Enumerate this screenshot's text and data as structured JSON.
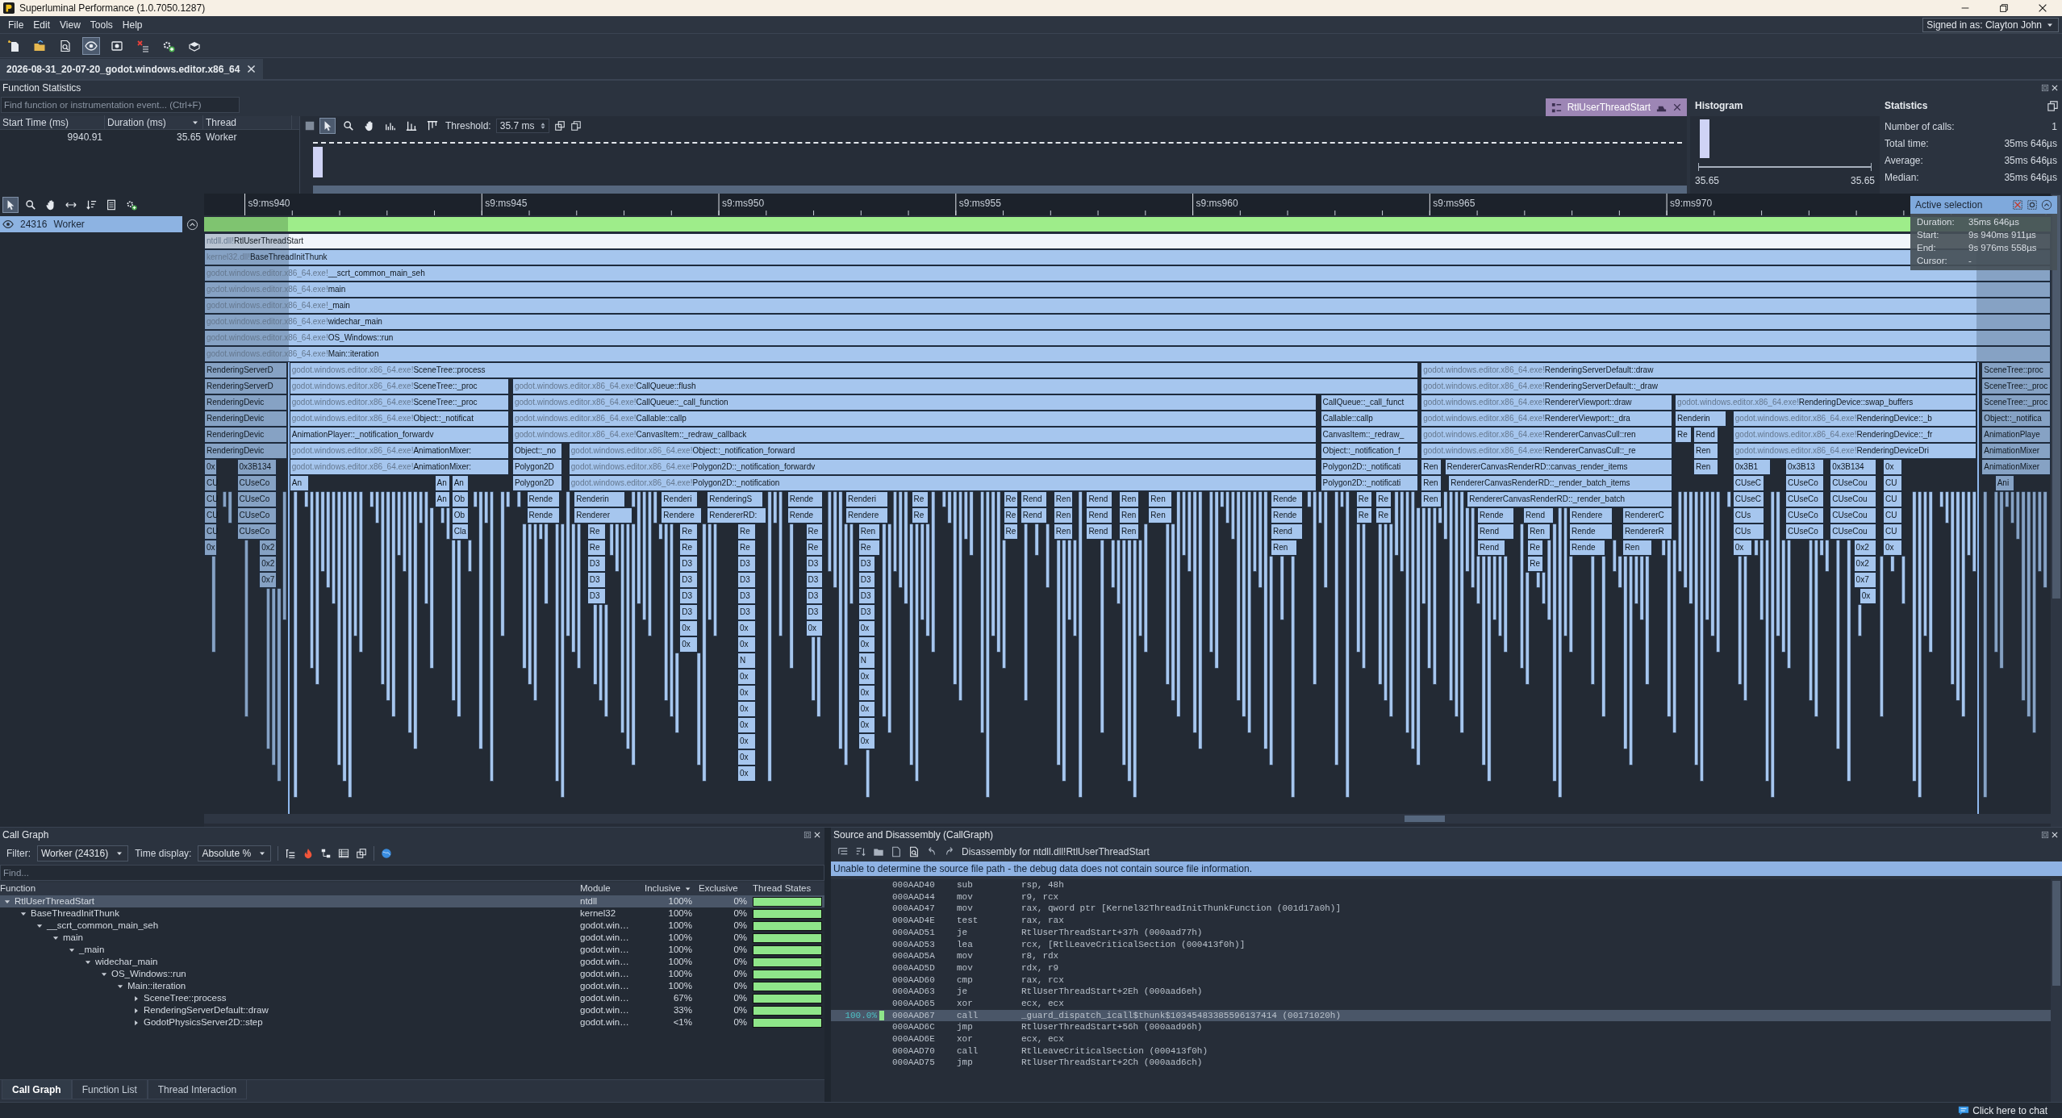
{
  "window": {
    "title": "Superluminal Performance (1.0.7050.1287)"
  },
  "menu": [
    "File",
    "Edit",
    "View",
    "Tools",
    "Help"
  ],
  "account": {
    "label": "Signed in as: Clayton John"
  },
  "toolbar": [
    {
      "selected": false
    },
    {
      "selected": false
    },
    {
      "selected": false
    },
    {
      "selected": true
    },
    {
      "selected": false
    },
    {
      "selected": false
    },
    {
      "selected": false
    },
    {
      "selected": false
    }
  ],
  "document_tabs": [
    {
      "label": "2026-08-31_20-07-20_godot.windows.editor.x86_64",
      "selected": true
    }
  ],
  "function_statistics": {
    "title": "Function Statistics",
    "search": {
      "placeholder": "Find function or instrumentation event... (Ctrl+F)"
    },
    "columns": [
      {
        "label": "Start Time (ms)",
        "sorted": false
      },
      {
        "label": "Duration (ms)",
        "sorted": true
      },
      {
        "label": "Thread",
        "sorted": false
      }
    ],
    "rows": [
      {
        "cells": [
          "9940.91",
          "35.65",
          "Worker"
        ],
        "selected": false
      }
    ],
    "tools": [
      {
        "selected": true
      },
      {
        "selected": false
      },
      {
        "selected": false
      },
      {
        "selected": false
      },
      {
        "selected": false
      },
      {
        "selected": false
      }
    ],
    "threshold_label": "Threshold:",
    "threshold": "35.7 ms",
    "function_tag": "RtlUserThreadStart"
  },
  "histogram": {
    "title": "Histogram",
    "min_label": "35.65",
    "max_label": "35.65"
  },
  "statistics": {
    "title": "Statistics",
    "rows": [
      {
        "label": "Number of calls:",
        "value": "1"
      },
      {
        "label": "Total time:",
        "value": "35ms 646µs"
      },
      {
        "label": "Average:",
        "value": "35ms 646µs"
      },
      {
        "label": "Median:",
        "value": "35ms 646µs"
      }
    ]
  },
  "timeline": {
    "tools": [
      {
        "selected": true
      },
      {
        "selected": false
      },
      {
        "selected": false
      },
      {
        "selected": false
      },
      {
        "selected": false
      },
      {
        "selected": false
      },
      {
        "selected": false
      }
    ],
    "threads": [
      {
        "id": "24316",
        "name": "Worker",
        "selected": true
      }
    ],
    "tick_labels": [
      "s9:ms940",
      "s9:ms945",
      "s9:ms950",
      "s9:ms955",
      "s9:ms960",
      "s9:ms965",
      "s9:ms970"
    ],
    "rows": [
      {
        "frames": [
          {
            "module": "ntdll.dll!",
            "name": "RtlUserThreadStart",
            "selected": true
          }
        ]
      },
      {
        "frames": [
          {
            "module": "kernel32.dll!",
            "name": "BaseThreadInitThunk",
            "selected": false
          }
        ]
      },
      {
        "frames": [
          {
            "module": "godot.windows.editor.x86_64.exe!",
            "name": "__scrt_common_main_seh",
            "selected": false
          }
        ]
      },
      {
        "frames": [
          {
            "module": "godot.windows.editor.x86_64.exe!",
            "name": "main",
            "selected": false
          }
        ]
      },
      {
        "frames": [
          {
            "module": "godot.windows.editor.x86_64.exe!",
            "name": "_main",
            "selected": false
          }
        ]
      },
      {
        "frames": [
          {
            "module": "godot.windows.editor.x86_64.exe!",
            "name": "widechar_main",
            "selected": false
          }
        ]
      },
      {
        "frames": [
          {
            "module": "godot.windows.editor.x86_64.exe!",
            "name": "OS_Windows::run",
            "selected": false
          }
        ]
      },
      {
        "frames": [
          {
            "module": "godot.windows.editor.x86_64.exe!",
            "name": "Main::iteration",
            "selected": false
          }
        ]
      },
      {
        "frames": [
          {
            "name": "RenderingServerD",
            "selected": false
          },
          {
            "module": "godot.windows.editor.x86_64.exe!",
            "name": "SceneTree::process",
            "selected": false
          },
          {
            "module": "godot.windows.editor.x86_64.exe!",
            "name": "RenderingServerDefault::draw",
            "selected": false
          },
          {
            "name": "SceneTree::proc",
            "selected": false
          }
        ]
      },
      {
        "frames": [
          {
            "name": "RenderingServerD",
            "selected": false
          },
          {
            "module": "godot.windows.editor.x86_64.exe!",
            "name": "SceneTree::_proc",
            "selected": false
          },
          {
            "module": "godot.windows.editor.x86_64.exe!",
            "name": "CallQueue::flush",
            "selected": false
          },
          {
            "module": "godot.windows.editor.x86_64.exe!",
            "name": "RenderingServerDefault::_draw",
            "selected": false
          },
          {
            "name": "SceneTree::_proc",
            "selected": false
          }
        ]
      },
      {
        "frames": [
          {
            "name": "RenderingDevic",
            "selected": false
          },
          {
            "module": "godot.windows.editor.x86_64.exe!",
            "name": "SceneTree::_proc",
            "selected": false
          },
          {
            "module": "godot.windows.editor.x86_64.exe!",
            "name": "CallQueue::_call_function",
            "selected": false
          },
          {
            "name": "CallQueue::_call_funct",
            "selected": false
          },
          {
            "module": "godot.windows.editor.x86_64.exe!",
            "name": "RendererViewport::draw",
            "selected": false
          },
          {
            "module": "godot.windows.editor.x86_64.exe!",
            "name": "RenderingDevice::swap_buffers",
            "selected": false
          },
          {
            "name": "SceneTree::_proc",
            "selected": false
          }
        ]
      },
      {
        "frames": [
          {
            "name": "RenderingDevic",
            "selected": false
          },
          {
            "module": "godot.windows.editor.x86_64.exe!",
            "name": "Object::_notificat",
            "selected": false
          },
          {
            "module": "godot.windows.editor.x86_64.exe!",
            "name": "Callable::callp",
            "selected": false
          },
          {
            "name": "Callable::callp",
            "selected": false
          },
          {
            "module": "godot.windows.editor.x86_64.exe!",
            "name": "RendererViewport::_dra",
            "selected": false
          },
          {
            "name": "Renderin",
            "selected": false
          },
          {
            "module": "godot.windows.editor.x86_64.exe!",
            "name": "RenderingDevice::_b",
            "selected": false
          },
          {
            "name": "Object::_notifica",
            "selected": false
          }
        ]
      },
      {
        "frames": [
          {
            "name": "RenderingDevic",
            "selected": false
          },
          {
            "name": "AnimationPlayer::_notification_forwardv",
            "selected": false
          },
          {
            "module": "godot.windows.editor.x86_64.exe!",
            "name": "CanvasItem::_redraw_callback",
            "selected": false
          },
          {
            "name": "CanvasItem::_redraw_",
            "selected": false
          },
          {
            "module": "godot.windows.editor.x86_64.exe!",
            "name": "RendererCanvasCull::ren",
            "selected": false
          },
          {
            "name": "Re",
            "selected": false
          },
          {
            "name": "Rend",
            "selected": false
          },
          {
            "module": "godot.windows.editor.x86_64.exe!",
            "name": "RenderingDevice::_fr",
            "selected": false
          },
          {
            "name": "AnimationPlaye",
            "selected": false
          }
        ]
      },
      {
        "frames": [
          {
            "name": "RenderingDevic",
            "selected": false
          },
          {
            "module": "godot.windows.editor.x86_64.exe!",
            "name": "AnimationMixer:",
            "selected": false
          },
          {
            "name": "Object::_no",
            "selected": false
          },
          {
            "module": "godot.windows.editor.x86_64.exe!",
            "name": "Object::_notification_forward",
            "selected": false
          },
          {
            "name": "Object::_notification_f",
            "selected": false
          },
          {
            "module": "godot.windows.editor.x86_64.exe!",
            "name": "RendererCanvasCull::_re",
            "selected": false
          },
          {
            "name": "Ren",
            "selected": false
          },
          {
            "module": "godot.windows.editor.x86_64.exe!",
            "name": "RenderingDeviceDri",
            "selected": false
          },
          {
            "name": "AnimationMixer",
            "selected": false
          }
        ]
      },
      {
        "frames": [
          {
            "name": "0x",
            "selected": false
          },
          {
            "name": "0x3B134",
            "selected": false
          },
          {
            "module": "godot.windows.editor.x86_64.exe!",
            "name": "AnimationMixer:",
            "selected": false
          },
          {
            "name": "Polygon2D",
            "selected": false
          },
          {
            "module": "godot.windows.editor.x86_64.exe!",
            "name": "Polygon2D::_notification_forwardv",
            "selected": false
          },
          {
            "name": "Polygon2D::_notificati",
            "selected": false
          },
          {
            "name": "Ren",
            "selected": false
          },
          {
            "name": "RendererCanvasRenderRD::canvas_render_items",
            "selected": false
          },
          {
            "name": "Ren",
            "selected": false
          },
          {
            "name": "0x3B1",
            "selected": false
          },
          {
            "name": "0x3B13",
            "selected": false
          },
          {
            "name": "0x3B134",
            "selected": false
          },
          {
            "name": "0x",
            "selected": false
          },
          {
            "name": "AnimationMixer",
            "selected": false
          }
        ]
      },
      {
        "frames": [
          {
            "name": "CU",
            "selected": false
          },
          {
            "name": "CUseCo",
            "selected": false
          },
          {
            "name": "An",
            "selected": false
          },
          {
            "name": "An",
            "selected": false
          },
          {
            "name": "An",
            "selected": false
          },
          {
            "name": "Polygon2D",
            "selected": false
          },
          {
            "module": "godot.windows.editor.x86_64.exe!",
            "name": "Polygon2D::_notification",
            "selected": false
          },
          {
            "name": "Polygon2D::_notificati",
            "selected": false
          },
          {
            "name": "Ren",
            "selected": false
          },
          {
            "name": "RendererCanvasRenderRD::_render_batch_items",
            "selected": false
          },
          {
            "name": "CUseC",
            "selected": false
          },
          {
            "name": "CUseCo",
            "selected": false
          },
          {
            "name": "CUseCou",
            "selected": false
          },
          {
            "name": "CU",
            "selected": false
          },
          {
            "name": "Ani",
            "selected": false
          }
        ]
      },
      {
        "frames": [
          {
            "name": "CU",
            "selected": false
          },
          {
            "name": "CUseCo",
            "selected": false
          },
          {
            "name": "An",
            "selected": false
          },
          {
            "name": "Ob",
            "selected": false
          },
          {
            "name": "Rende",
            "selected": false
          },
          {
            "name": "Renderin",
            "selected": false
          },
          {
            "name": "Renderi",
            "selected": false
          },
          {
            "name": "RenderingS",
            "selected": false
          },
          {
            "name": "Rende",
            "selected": false
          },
          {
            "name": "Renderi",
            "selected": false
          },
          {
            "name": "Re",
            "selected": false
          },
          {
            "name": "Re",
            "selected": false
          },
          {
            "name": "Rend",
            "selected": false
          },
          {
            "name": "Ren",
            "selected": false
          },
          {
            "name": "Rend",
            "selected": false
          },
          {
            "name": "Ren",
            "selected": false
          },
          {
            "name": "Ren",
            "selected": false
          },
          {
            "name": "Rende",
            "selected": false
          },
          {
            "name": "Re",
            "selected": false
          },
          {
            "name": "Re",
            "selected": false
          },
          {
            "name": "Ren",
            "selected": false
          },
          {
            "name": "RendererCanvasRenderRD::_render_batch",
            "selected": false
          },
          {
            "name": "CUseC",
            "selected": false
          },
          {
            "name": "CUseCo",
            "selected": false
          },
          {
            "name": "CUseCou",
            "selected": false
          },
          {
            "name": "CU",
            "selected": false
          }
        ]
      },
      {
        "frames": [
          {
            "name": "CU",
            "selected": false
          },
          {
            "name": "CUseCo",
            "selected": false
          },
          {
            "name": "Ob",
            "selected": false
          },
          {
            "name": "Rende",
            "selected": false
          },
          {
            "name": "Renderer",
            "selected": false
          },
          {
            "name": "Rendere",
            "selected": false
          },
          {
            "name": "RendererRD:",
            "selected": false
          },
          {
            "name": "Rende",
            "selected": false
          },
          {
            "name": "Rendere",
            "selected": false
          },
          {
            "name": "Re",
            "selected": false
          },
          {
            "name": "Re",
            "selected": false
          },
          {
            "name": "Rend",
            "selected": false
          },
          {
            "name": "Ren",
            "selected": false
          },
          {
            "name": "Rend",
            "selected": false
          },
          {
            "name": "Ren",
            "selected": false
          },
          {
            "name": "Ren",
            "selected": false
          },
          {
            "name": "Rende",
            "selected": false
          },
          {
            "name": "Re",
            "selected": false
          },
          {
            "name": "Re",
            "selected": false
          },
          {
            "name": "Rende",
            "selected": false
          },
          {
            "name": "Rend",
            "selected": false
          },
          {
            "name": "Rendere",
            "selected": false
          },
          {
            "name": "RendererC",
            "selected": false
          },
          {
            "name": "CUs",
            "selected": false
          },
          {
            "name": "CUseCo",
            "selected": false
          },
          {
            "name": "CUseCou",
            "selected": false
          },
          {
            "name": "CU",
            "selected": false
          }
        ]
      },
      {
        "frames": [
          {
            "name": "CU",
            "selected": false
          },
          {
            "name": "CUseCo",
            "selected": false
          },
          {
            "name": "Cla",
            "selected": false
          },
          {
            "name": "Re",
            "selected": false
          },
          {
            "name": "Re",
            "selected": false
          },
          {
            "name": "Re",
            "selected": false
          },
          {
            "name": "Re",
            "selected": false
          },
          {
            "name": "Ren",
            "selected": false
          },
          {
            "name": "Re",
            "selected": false
          },
          {
            "name": "Ren",
            "selected": false
          },
          {
            "name": "Rend",
            "selected": false
          },
          {
            "name": "Ren",
            "selected": false
          },
          {
            "name": "Rend",
            "selected": false
          },
          {
            "name": "Rend",
            "selected": false
          },
          {
            "name": "Ren",
            "selected": false
          },
          {
            "name": "Rende",
            "selected": false
          },
          {
            "name": "RendererR",
            "selected": false
          },
          {
            "name": "CUs",
            "selected": false
          },
          {
            "name": "CUseCo",
            "selected": false
          },
          {
            "name": "CUseCou",
            "selected": false
          },
          {
            "name": "CU",
            "selected": false
          }
        ]
      },
      {
        "frames": [
          {
            "name": "0x",
            "selected": false
          },
          {
            "name": "0x2",
            "selected": false
          },
          {
            "name": "Re",
            "selected": false
          },
          {
            "name": "Re",
            "selected": false
          },
          {
            "name": "Re",
            "selected": false
          },
          {
            "name": "Re",
            "selected": false
          },
          {
            "name": "Re",
            "selected": false
          },
          {
            "name": "Ren",
            "selected": false
          },
          {
            "name": "Rend",
            "selected": false
          },
          {
            "name": "Re",
            "selected": false
          },
          {
            "name": "Rende",
            "selected": false
          },
          {
            "name": "Ren",
            "selected": false
          },
          {
            "name": "0x",
            "selected": false
          },
          {
            "name": "0x2",
            "selected": false
          },
          {
            "name": "0x",
            "selected": false
          }
        ]
      },
      {
        "frames": [
          {
            "name": "0x2",
            "selected": false
          },
          {
            "name": "D3",
            "selected": false
          },
          {
            "name": "D3",
            "selected": false
          },
          {
            "name": "D3",
            "selected": false
          },
          {
            "name": "D3",
            "selected": false
          },
          {
            "name": "D3",
            "selected": false
          },
          {
            "name": "Re",
            "selected": false
          },
          {
            "name": "0x2",
            "selected": false
          }
        ]
      },
      {
        "frames": [
          {
            "name": "0x7",
            "selected": false
          },
          {
            "name": "D3",
            "selected": false
          },
          {
            "name": "D3",
            "selected": false
          },
          {
            "name": "D3",
            "selected": false
          },
          {
            "name": "D3",
            "selected": false
          },
          {
            "name": "D3",
            "selected": false
          },
          {
            "name": "0x7",
            "selected": false
          }
        ]
      },
      {
        "frames": [
          {
            "name": "D3",
            "selected": false
          },
          {
            "name": "D3",
            "selected": false
          },
          {
            "name": "D3",
            "selected": false
          },
          {
            "name": "D3",
            "selected": false
          },
          {
            "name": "D3",
            "selected": false
          },
          {
            "name": "0x",
            "selected": false
          }
        ]
      },
      {
        "frames": [
          {
            "name": "D3",
            "selected": false
          },
          {
            "name": "D3",
            "selected": false
          },
          {
            "name": "D3",
            "selected": false
          },
          {
            "name": "D3",
            "selected": false
          }
        ]
      },
      {
        "frames": [
          {
            "name": "0x",
            "selected": false
          },
          {
            "name": "0x",
            "selected": false
          },
          {
            "name": "0x",
            "selected": false
          },
          {
            "name": "0x",
            "selected": false
          }
        ]
      },
      {
        "frames": [
          {
            "name": "0x",
            "selected": false
          },
          {
            "name": "0x",
            "selected": false
          },
          {
            "name": "0x",
            "selected": false
          }
        ]
      },
      {
        "frames": [
          {
            "name": "N",
            "selected": false
          },
          {
            "name": "N",
            "selected": false
          }
        ]
      },
      {
        "frames": [
          {
            "name": "0x",
            "selected": false
          },
          {
            "name": "0x",
            "selected": false
          }
        ]
      },
      {
        "frames": [
          {
            "name": "0x",
            "selected": false
          },
          {
            "name": "0x",
            "selected": false
          }
        ]
      },
      {
        "frames": [
          {
            "name": "0x",
            "selected": false
          },
          {
            "name": "0x",
            "selected": false
          }
        ]
      },
      {
        "frames": [
          {
            "name": "0x",
            "selected": false
          },
          {
            "name": "0x",
            "selected": false
          }
        ]
      },
      {
        "frames": [
          {
            "name": "0x",
            "selected": false
          },
          {
            "name": "0x",
            "selected": false
          }
        ]
      },
      {
        "frames": [
          {
            "name": "0x",
            "selected": false
          }
        ]
      },
      {
        "frames": [
          {
            "name": "0x",
            "selected": false
          }
        ]
      }
    ]
  },
  "active_selection": {
    "title": "Active selection",
    "rows": [
      {
        "label": "Duration:",
        "value": "35ms 646µs"
      },
      {
        "label": "Start:",
        "value": "9s 940ms 911µs"
      },
      {
        "label": "End:",
        "value": "9s 976ms 558µs"
      },
      {
        "label": "Cursor:",
        "value": "-"
      }
    ]
  },
  "call_graph": {
    "title": "Call Graph",
    "filter_label": "Filter:",
    "filter": "Worker (24316)",
    "time_display_label": "Time display:",
    "time_display": "Absolute %",
    "find": {
      "placeholder": "Find..."
    },
    "columns": [
      {
        "label": "Function",
        "sorted": false
      },
      {
        "label": "Module",
        "sorted": false
      },
      {
        "label": "Inclusive",
        "sorted": true
      },
      {
        "label": "Exclusive",
        "sorted": false
      },
      {
        "label": "Thread States",
        "sorted": false
      }
    ],
    "tree": [
      {
        "name": "RtlUserThreadStart",
        "module": "ntdll",
        "inclusive": "100%",
        "exclusive": "0%",
        "expanded": true,
        "selected": true,
        "children": [
          {
            "name": "BaseThreadInitThunk",
            "module": "kernel32",
            "inclusive": "100%",
            "exclusive": "0%",
            "expanded": true,
            "selected": false,
            "children": [
              {
                "name": "__scrt_common_main_seh",
                "module": "godot.win…",
                "inclusive": "100%",
                "exclusive": "0%",
                "expanded": true,
                "selected": false,
                "children": [
                  {
                    "name": "main",
                    "module": "godot.win…",
                    "inclusive": "100%",
                    "exclusive": "0%",
                    "expanded": true,
                    "selected": false,
                    "children": [
                      {
                        "name": "_main",
                        "module": "godot.win…",
                        "inclusive": "100%",
                        "exclusive": "0%",
                        "expanded": true,
                        "selected": false,
                        "children": [
                          {
                            "name": "widechar_main",
                            "module": "godot.win…",
                            "inclusive": "100%",
                            "exclusive": "0%",
                            "expanded": true,
                            "selected": false,
                            "children": [
                              {
                                "name": "OS_Windows::run",
                                "module": "godot.win…",
                                "inclusive": "100%",
                                "exclusive": "0%",
                                "expanded": true,
                                "selected": false,
                                "children": [
                                  {
                                    "name": "Main::iteration",
                                    "module": "godot.win…",
                                    "inclusive": "100%",
                                    "exclusive": "0%",
                                    "expanded": true,
                                    "selected": false,
                                    "children": [
                                      {
                                        "name": "SceneTree::process",
                                        "module": "godot.win…",
                                        "inclusive": "67%",
                                        "exclusive": "0%",
                                        "expanded": false,
                                        "selected": false
                                      },
                                      {
                                        "name": "RenderingServerDefault::draw",
                                        "module": "godot.win…",
                                        "inclusive": "33%",
                                        "exclusive": "0%",
                                        "expanded": false,
                                        "selected": false
                                      },
                                      {
                                        "name": "GodotPhysicsServer2D::step",
                                        "module": "godot.win…",
                                        "inclusive": "<1%",
                                        "exclusive": "0%",
                                        "expanded": false,
                                        "selected": false
                                      }
                                    ]
                                  }
                                ]
                              }
                            ]
                          }
                        ]
                      }
                    ]
                  }
                ]
              }
            ]
          }
        ]
      }
    ],
    "tabs": [
      {
        "label": "Call Graph",
        "selected": true
      },
      {
        "label": "Function List",
        "selected": false
      },
      {
        "label": "Thread Interaction",
        "selected": false
      }
    ]
  },
  "disassembly": {
    "title": "Source and Disassembly (CallGraph)",
    "heading": "Disassembly for ntdll.dll!RtlUserThreadStart",
    "notice": "Unable to determine the source file path - the debug data does not contain source file information.",
    "lines": [
      {
        "address": "000AAD40",
        "op": "sub",
        "args": "rsp, 48h",
        "selected": false
      },
      {
        "address": "000AAD44",
        "op": "mov",
        "args": "r9, rcx",
        "selected": false
      },
      {
        "address": "000AAD47",
        "op": "mov",
        "args": "rax, qword ptr [Kernel32ThreadInitThunkFunction (001d17a0h)]",
        "selected": false
      },
      {
        "address": "000AAD4E",
        "op": "test",
        "args": "rax, rax",
        "selected": false
      },
      {
        "address": "000AAD51",
        "op": "je",
        "args": "RtlUserThreadStart+37h (000aad77h)",
        "selected": false
      },
      {
        "address": "000AAD53",
        "op": "lea",
        "args": "rcx, [RtlLeaveCriticalSection (000413f0h)]",
        "selected": false
      },
      {
        "address": "000AAD5A",
        "op": "mov",
        "args": "r8, rdx",
        "selected": false
      },
      {
        "address": "000AAD5D",
        "op": "mov",
        "args": "rdx, r9",
        "selected": false
      },
      {
        "address": "000AAD60",
        "op": "cmp",
        "args": "rax, rcx",
        "selected": false
      },
      {
        "address": "000AAD63",
        "op": "je",
        "args": "RtlUserThreadStart+2Eh (000aad6eh)",
        "selected": false
      },
      {
        "address": "000AAD65",
        "op": "xor",
        "args": "ecx, ecx",
        "selected": false
      },
      {
        "address": "000AAD67",
        "op": "call",
        "args": "_guard_dispatch_icall$thunk$10345483385596137414 (00171020h)",
        "selected": true,
        "percent": "100.0%"
      },
      {
        "address": "000AAD6C",
        "op": "jmp",
        "args": "RtlUserThreadStart+56h (000aad96h)",
        "selected": false
      },
      {
        "address": "000AAD6E",
        "op": "xor",
        "args": "ecx, ecx",
        "selected": false
      },
      {
        "address": "000AAD70",
        "op": "call",
        "args": "RtlLeaveCriticalSection (000413f0h)",
        "selected": false
      },
      {
        "address": "000AAD75",
        "op": "jmp",
        "args": "RtlUserThreadStart+2Ch (000aad6ch)",
        "selected": false
      }
    ]
  },
  "status_bar": {
    "chat": "Click here to chat"
  }
}
